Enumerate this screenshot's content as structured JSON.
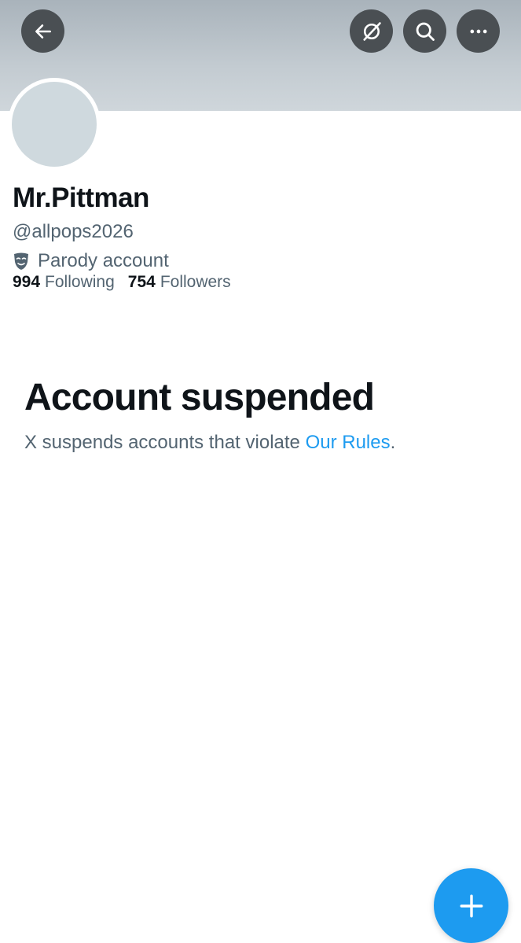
{
  "header": {
    "back_icon": "arrow-left-icon",
    "grok_icon": "grok-icon",
    "search_icon": "search-icon",
    "more_icon": "more-horizontal-icon"
  },
  "profile": {
    "name": "Mr.Pittman",
    "handle": "@allpops2026",
    "parody_label": "Parody account",
    "parody_icon": "theater-mask-icon",
    "following_count": "994",
    "following_label": "Following",
    "followers_count": "754",
    "followers_label": "Followers"
  },
  "suspension": {
    "title": "Account suspended",
    "message": "X suspends accounts that violate ",
    "link_text": "Our Rules",
    "message_end": "."
  },
  "fab": {
    "icon": "plus-icon"
  },
  "colors": {
    "accent": "#1d9bf0",
    "text_primary": "#0f1419",
    "text_secondary": "#536471",
    "header_button": "#4a4f53",
    "avatar_placeholder": "#cfd9de"
  }
}
